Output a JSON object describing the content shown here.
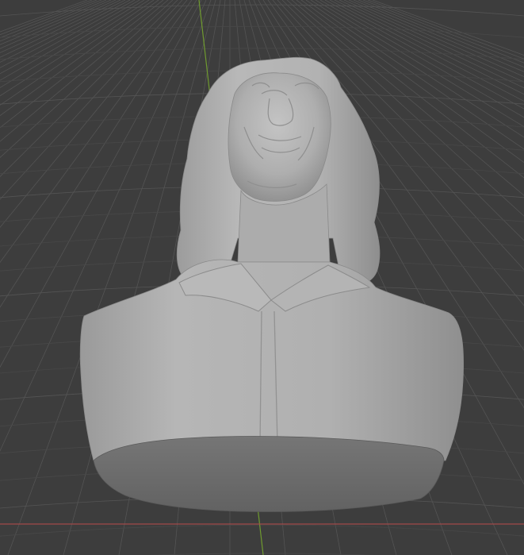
{
  "viewport": {
    "background_color": "#3d3d3d",
    "grid_line_color": "#545454",
    "grid_minor_color": "#484848",
    "y_axis_color": "#6f9a2f",
    "x_axis_color": "#a14a4a",
    "model_base_color": "#a6a6a6",
    "model_underside_color": "#6e6e6e",
    "model_outline_color": "#8a8a8a"
  },
  "scene": {
    "object_name": "sculpted-bust",
    "view_mode": "solid-shading",
    "visible_axes": [
      "y-axis",
      "x-axis"
    ]
  }
}
